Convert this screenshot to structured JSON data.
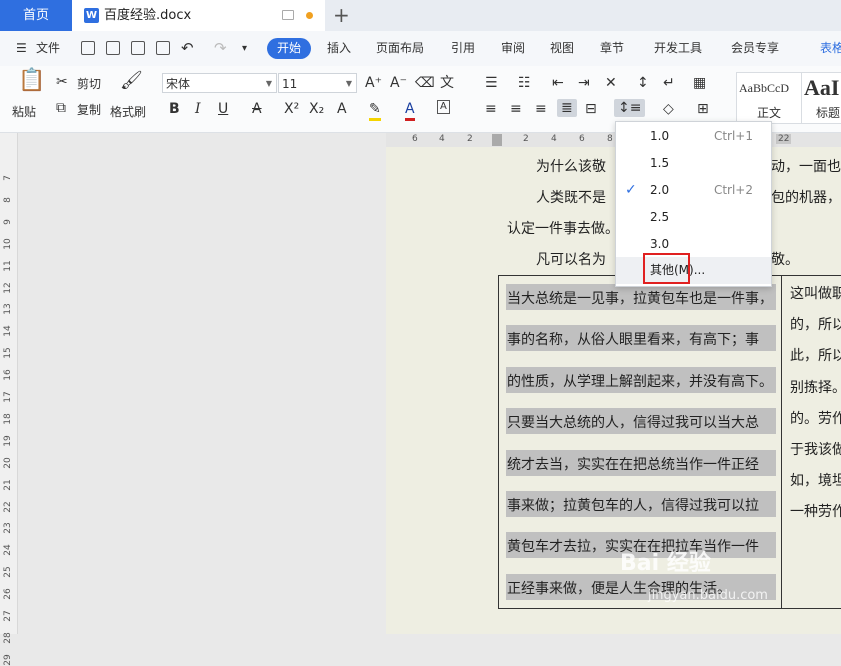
{
  "tabs": {
    "home": "首页",
    "doc_title": "百度经验.docx",
    "add": "+"
  },
  "menu": {
    "file": "文件",
    "items": [
      "开始",
      "插入",
      "页面布局",
      "引用",
      "审阅",
      "视图",
      "章节",
      "开发工具",
      "会员专享",
      "表格"
    ]
  },
  "ribbon": {
    "paste": "粘贴",
    "cut": "剪切",
    "copy": "复制",
    "format_painter": "格式刷",
    "font_name": "宋体",
    "font_size": "11",
    "style_preview": "AaBbCcD",
    "style_normal": "正文",
    "style_heading_preview": "AaI",
    "style_heading": "标题"
  },
  "ruler": {
    "h": [
      "6",
      "4",
      "2",
      "",
      "2",
      "4",
      "6",
      "8",
      "",
      "22"
    ],
    "v": [
      "7",
      "8",
      "9",
      "10",
      "11",
      "12",
      "13",
      "14",
      "15",
      "16",
      "17",
      "18",
      "19",
      "20",
      "21",
      "22",
      "23",
      "24",
      "25",
      "26",
      "27",
      "28",
      "29"
    ]
  },
  "doc": {
    "line1a": "为什么该敬",
    "line1b": "动，一面也",
    "line2a": "人类既不是",
    "line2b": "包的机器，",
    "line3": "认定一件事去做。",
    "line4a": "凡可以名为",
    "line4b": "敬。",
    "left_cell": [
      "当大总统是一见事，拉黄包车也是一件事，",
      "事的名称，从俗人眼里看来，有高下；事",
      "的性质，从学理上解剖起来，并没有高下。",
      "只要当大总统的人，信得过我可以当大总",
      "统才去当，实实在在把总统当作一件正经",
      "事来做；拉黄包车的人，信得过我可以拉",
      "黄包车才去拉，实实在在把拉车当作一件",
      "正经事来做，便是人生合理的生活。"
    ],
    "right_cell": [
      "这叫做职",
      "的，所以",
      "此，所以",
      "别拣择。",
      "的。劳作",
      "于我该做",
      "如，境坦",
      "一种劳作"
    ]
  },
  "line_spacing_menu": {
    "items": [
      {
        "value": "1.0",
        "shortcut": "Ctrl+1"
      },
      {
        "value": "1.5",
        "shortcut": ""
      },
      {
        "value": "2.0",
        "shortcut": "Ctrl+2"
      },
      {
        "value": "2.5",
        "shortcut": ""
      },
      {
        "value": "3.0",
        "shortcut": ""
      }
    ],
    "checked": "2.0",
    "other": "其他(M)..."
  },
  "watermark": {
    "brand": "Bai 经验",
    "url": "jingyan.baidu.com"
  },
  "colors": {
    "accent": "#2f6fe0",
    "highlight_box": "#e02020"
  }
}
